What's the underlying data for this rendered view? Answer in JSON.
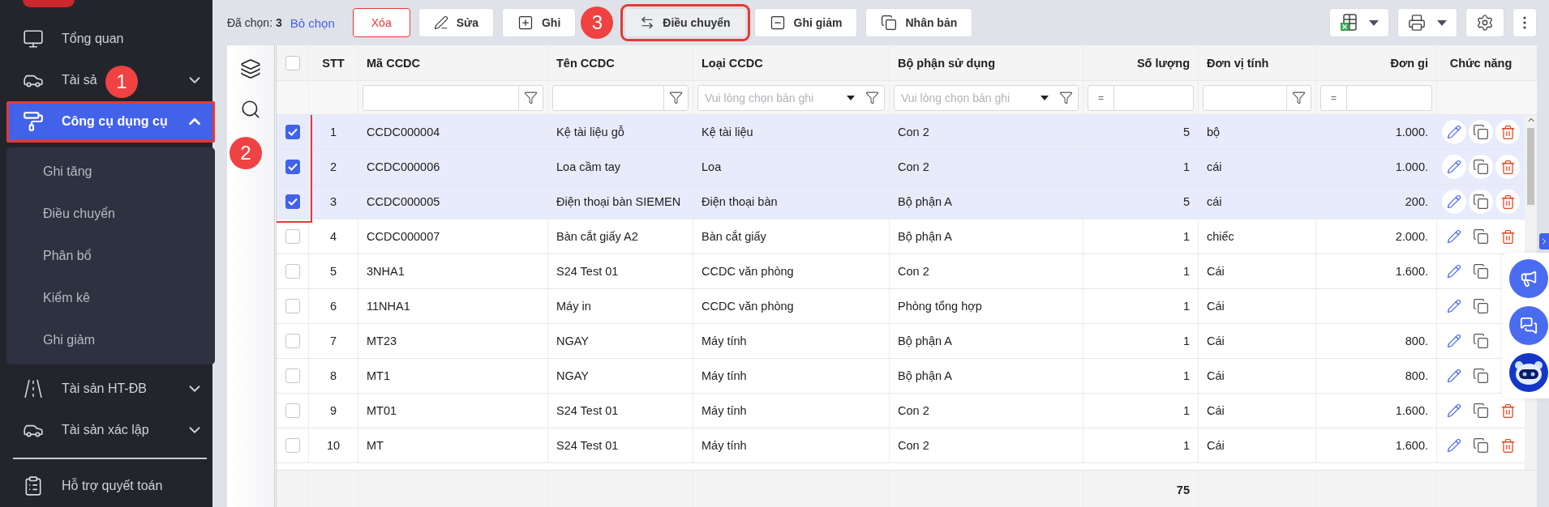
{
  "sidebar": {
    "items": [
      {
        "label": "Tổng quan",
        "selected": false,
        "highlighted": false
      },
      {
        "label": "Tài sả",
        "selected": false,
        "highlighted": false,
        "expanded": false,
        "badge": "1"
      },
      {
        "label": "Công cụ dụng cụ",
        "selected": true,
        "highlighted": true,
        "expanded": true,
        "children": [
          {
            "label": "Ghi tăng"
          },
          {
            "label": "Điều chuyển"
          },
          {
            "label": "Phân bổ"
          },
          {
            "label": "Kiểm kê"
          },
          {
            "label": "Ghi giảm"
          }
        ]
      },
      {
        "label": "Tài sản HT-ĐB",
        "selected": false,
        "highlighted": false,
        "expanded": false
      },
      {
        "label": "Tài sản xác lập",
        "selected": false,
        "highlighted": false,
        "expanded": false
      },
      {
        "label": "Hỗ trợ quyết toán",
        "selected": false,
        "highlighted": false,
        "divider_above": true
      }
    ]
  },
  "toolbar": {
    "selection": "Đã chọn: **3**",
    "clear_link": "Bỏ chọn",
    "buttons": [
      {
        "kind": "danger",
        "label": "Xóa",
        "highlighted": false
      },
      {
        "kind": "edit",
        "label": "Sửa",
        "highlighted": false
      },
      {
        "kind": "add",
        "label": "Ghi",
        "highlighted": false,
        "badge": "3"
      },
      {
        "kind": "transfer",
        "label": "Điều chuyển",
        "highlighted": true
      },
      {
        "kind": "reduce",
        "label": "Ghi giảm",
        "highlighted": false
      },
      {
        "kind": "clone",
        "label": "Nhân bản",
        "highlighted": false
      }
    ]
  },
  "table": {
    "badge": "2",
    "all_selected": false,
    "columns": [
      {
        "label": "STT",
        "kind": "none"
      },
      {
        "label": "Mã CCDC",
        "kind": "text"
      },
      {
        "label": "Tên CCDC",
        "kind": "text"
      },
      {
        "label": "Loại CCDC",
        "kind": "select",
        "placeholder": "Vui lòng chọn bản ghi"
      },
      {
        "label": "Bộ phận sử dụng",
        "kind": "select",
        "placeholder": "Vui lòng chọn bản ghi"
      },
      {
        "label": "Số lượng",
        "kind": "number",
        "operator": "="
      },
      {
        "label": "Đơn vị tính",
        "kind": "text"
      },
      {
        "label": "Đơn gi",
        "kind": "number",
        "operator": "="
      },
      {
        "label": "Chức năng",
        "kind": "none"
      }
    ],
    "rows": [
      {
        "selected": true,
        "delete_icon": true,
        "cells": [
          "1",
          "CCDC000004",
          "Kệ tài liệu gỗ",
          "Kệ tài liệu",
          "Con 2",
          "5",
          "bộ",
          "1.000."
        ]
      },
      {
        "selected": true,
        "delete_icon": true,
        "cells": [
          "2",
          "CCDC000006",
          "Loa cầm tay",
          "Loa",
          "Con 2",
          "1",
          "cái",
          "1.000."
        ]
      },
      {
        "selected": true,
        "delete_icon": true,
        "cells": [
          "3",
          "CCDC000005",
          "Điện thoại bàn SIEMEN",
          "Điện thoại bàn",
          "Bộ phận A",
          "5",
          "cái",
          "200."
        ]
      },
      {
        "selected": false,
        "delete_icon": true,
        "cells": [
          "4",
          "CCDC000007",
          "Bàn cắt giấy A2",
          "Bàn cắt giấy",
          "Bộ phận A",
          "1",
          "chiếc",
          "2.000."
        ]
      },
      {
        "selected": false,
        "delete_icon": false,
        "cells": [
          "5",
          "3NHA1",
          "S24 Test 01",
          "CCDC văn phòng",
          "Con 2",
          "1",
          "Cái",
          "1.600."
        ]
      },
      {
        "selected": false,
        "delete_icon": false,
        "cells": [
          "6",
          "11NHA1",
          "Máy in",
          "CCDC văn phòng",
          "Phòng tổng hợp",
          "1",
          "Cái",
          ""
        ]
      },
      {
        "selected": false,
        "delete_icon": false,
        "cells": [
          "7",
          "MT23",
          "NGAY",
          "Máy tính",
          "Bộ phận A",
          "1",
          "Cái",
          "800."
        ]
      },
      {
        "selected": false,
        "delete_icon": false,
        "cells": [
          "8",
          "MT1",
          "NGAY",
          "Máy tính",
          "Bộ phận A",
          "1",
          "Cái",
          "800."
        ]
      },
      {
        "selected": false,
        "delete_icon": true,
        "cells": [
          "9",
          "MT01",
          "S24 Test 01",
          "Máy tính",
          "Con 2",
          "1",
          "Cái",
          "1.600."
        ]
      },
      {
        "selected": false,
        "delete_icon": true,
        "cells": [
          "10",
          "MT",
          "S24 Test 01",
          "Máy tính",
          "Con 2",
          "1",
          "Cái",
          "1.600."
        ]
      }
    ],
    "footer": {
      "total_quantity": "75"
    }
  }
}
